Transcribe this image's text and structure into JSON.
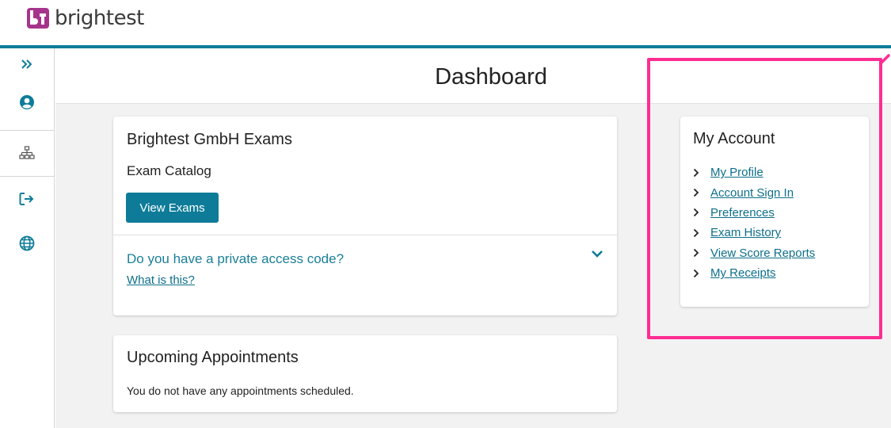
{
  "brand": {
    "name": "brightest",
    "colors": {
      "accent": "#0e7c99",
      "logo_magenta": "#a6348c",
      "highlight": "#ff2d92"
    }
  },
  "sidebar": {
    "items": [
      {
        "icon": "chevron-double-right-icon"
      },
      {
        "icon": "user-circle-icon"
      },
      {
        "icon": "sitemap-icon"
      },
      {
        "icon": "sign-out-icon"
      },
      {
        "icon": "globe-icon"
      }
    ]
  },
  "page": {
    "title": "Dashboard"
  },
  "exams_card": {
    "title": "Brightest GmbH Exams",
    "subtitle": "Exam Catalog",
    "button_label": "View Exams",
    "access_code_question": "Do you have a private access code?",
    "what_is_this_link": "What is this?"
  },
  "appointments_card": {
    "title": "Upcoming Appointments",
    "empty_message": "You do not have any appointments scheduled."
  },
  "account_card": {
    "title": "My Account",
    "links": [
      {
        "label": "My Profile"
      },
      {
        "label": "Account Sign In"
      },
      {
        "label": "Preferences"
      },
      {
        "label": "Exam History"
      },
      {
        "label": "View Score Reports"
      },
      {
        "label": "My Receipts"
      }
    ]
  }
}
